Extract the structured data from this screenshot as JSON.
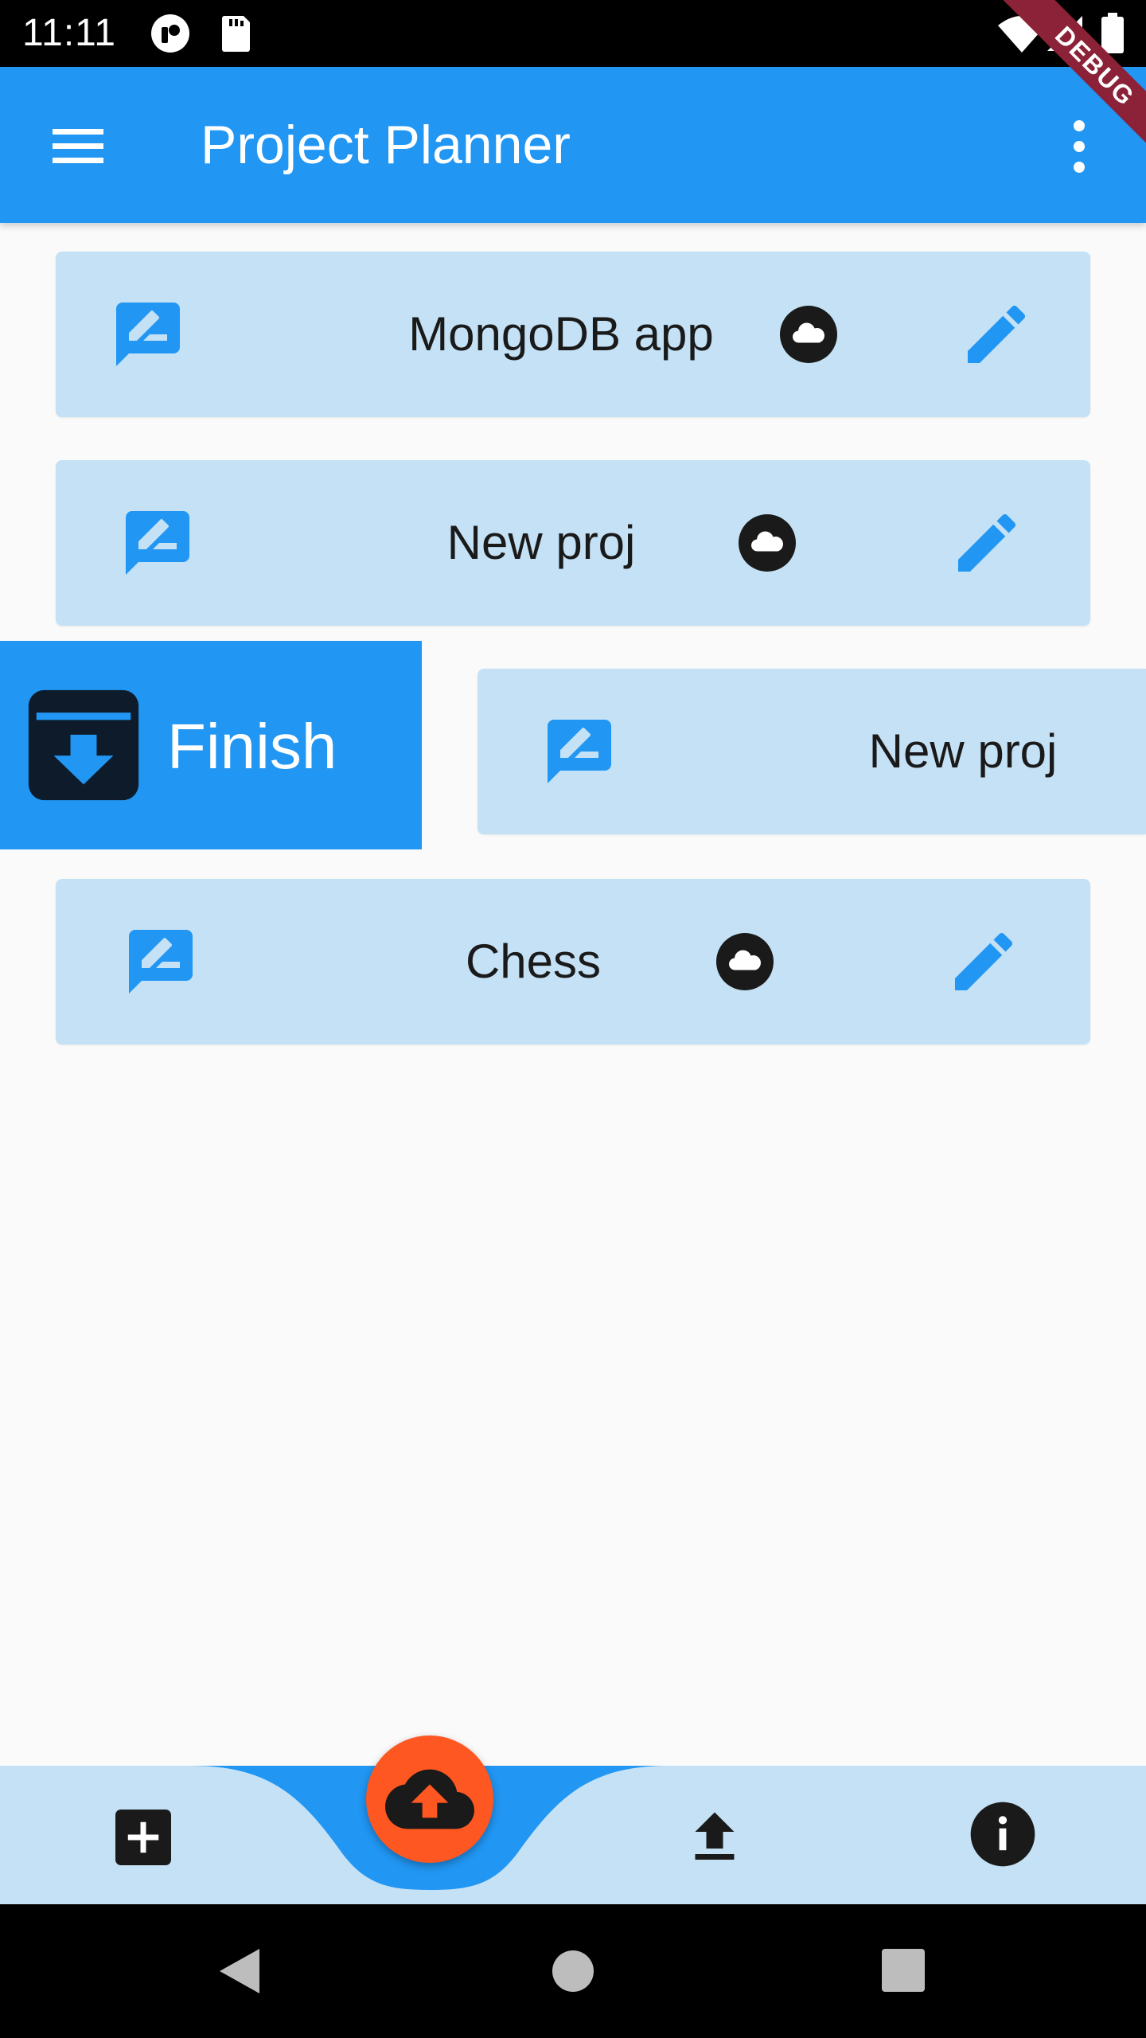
{
  "status_bar": {
    "time": "11:11",
    "icons": [
      "notification-icon",
      "sd-card-icon",
      "wifi-icon",
      "signal-icon",
      "battery-icon"
    ]
  },
  "app_bar": {
    "title": "Project Planner",
    "menu_icon": "menu-icon",
    "overflow_icon": "more-vert-icon"
  },
  "debug_banner": "DEBUG",
  "projects": [
    {
      "title": "MongoDB app"
    },
    {
      "title": "New proj"
    },
    {
      "title": "New proj"
    },
    {
      "title": "Chess"
    }
  ],
  "swipe_action": {
    "label": "Finish",
    "icon": "archive-icon"
  },
  "bottom_bar": {
    "items": [
      "add-box-icon",
      "cloud-upload-icon",
      "upload-icon",
      "info-icon"
    ]
  },
  "colors": {
    "primary": "#2196f3",
    "card": "#c4e1f5",
    "fab": "#ff5722",
    "background": "#fafafa",
    "debug": "#8b2238"
  }
}
